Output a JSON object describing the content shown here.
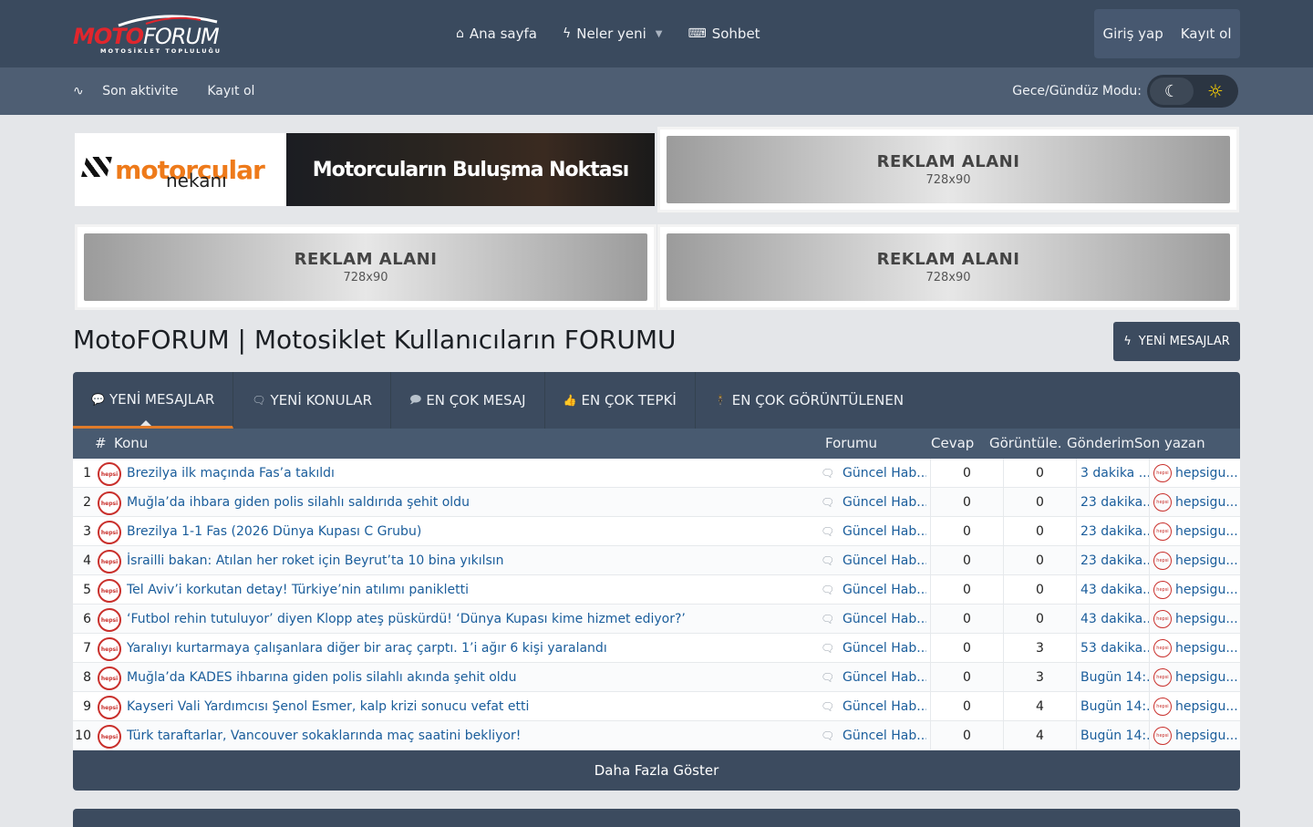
{
  "header": {
    "logo": {
      "moto": "MOTO",
      "forum": "FORUM",
      "subtitle": "MOTOSİKLET TOPLULUĞU"
    },
    "nav": [
      {
        "label": "Ana sayfa",
        "icon": "home-icon"
      },
      {
        "label": "Neler yeni",
        "icon": "bolt-icon"
      },
      {
        "label": "Sohbet",
        "icon": "chat-icon"
      }
    ],
    "login": "Giriş yap",
    "register": "Kayıt ol"
  },
  "subnav": {
    "activity": "Son aktivite",
    "register": "Kayıt ol",
    "mode_label": "Gece/Gündüz Modu:"
  },
  "ads": {
    "banner_brand": "motorcular",
    "banner_brand2": "nekanı",
    "banner_text": "Motorcuların Buluşma Noktası",
    "placeholder_title": "REKLAM ALANI",
    "placeholder_size": "728x90"
  },
  "page": {
    "title": "MotoFORUM | Motosiklet Kullanıcıların FORUMU",
    "new_messages_button": "YENİ MESAJLAR"
  },
  "tabs": [
    {
      "label": "YENİ MESAJLAR",
      "icon": "chat-bubble-icon",
      "active": true
    },
    {
      "label": "YENİ KONULAR",
      "icon": "chat-bubbles-icon",
      "active": false
    },
    {
      "label": "EN ÇOK MESAJ",
      "icon": "message-icon",
      "active": false
    },
    {
      "label": "EN ÇOK TEPKİ",
      "icon": "thumbs-up-icon",
      "active": false
    },
    {
      "label": "EN ÇOK GÖRÜNTÜLENEN",
      "icon": "eye-person-icon",
      "active": false
    }
  ],
  "table": {
    "headers": {
      "hash": "#",
      "topic": "Konu",
      "forum": "Forumu",
      "answers": "Cevap",
      "views": "Görüntüle...",
      "sent": "Gönderim",
      "last": "Son yazan"
    },
    "rows": [
      {
        "n": "1",
        "title": "Brezilya ilk maçında Fas’a takıldı",
        "forum": "Güncel Hab...",
        "answers": "0",
        "views": "0",
        "time": "3 dakika ...",
        "last": "hepsigu..."
      },
      {
        "n": "2",
        "title": "Muğla’da ihbara giden polis silahlı saldırıda şehit oldu",
        "forum": "Güncel Hab...",
        "answers": "0",
        "views": "0",
        "time": "23 dakika...",
        "last": "hepsigu..."
      },
      {
        "n": "3",
        "title": "Brezilya 1-1 Fas (2026 Dünya Kupası C Grubu)",
        "forum": "Güncel Hab...",
        "answers": "0",
        "views": "0",
        "time": "23 dakika...",
        "last": "hepsigu..."
      },
      {
        "n": "4",
        "title": "İsrailli bakan: Atılan her roket için Beyrut’ta 10 bina yıkılsın",
        "forum": "Güncel Hab...",
        "answers": "0",
        "views": "0",
        "time": "23 dakika...",
        "last": "hepsigu..."
      },
      {
        "n": "5",
        "title": "Tel Aviv’i korkutan detay! Türkiye’nin atılımı panikletti",
        "forum": "Güncel Hab...",
        "answers": "0",
        "views": "0",
        "time": "43 dakika...",
        "last": "hepsigu..."
      },
      {
        "n": "6",
        "title": "‘Futbol rehin tutuluyor’ diyen Klopp ateş püskürdü! ‘Dünya Kupası kime hizmet ediyor?’",
        "forum": "Güncel Hab...",
        "answers": "0",
        "views": "0",
        "time": "43 dakika...",
        "last": "hepsigu..."
      },
      {
        "n": "7",
        "title": "Yaralıyı kurtarmaya çalışanlara diğer bir araç çarptı. 1’i ağır 6 kişi yaralandı",
        "forum": "Güncel Hab...",
        "answers": "0",
        "views": "3",
        "time": "53 dakika...",
        "last": "hepsigu..."
      },
      {
        "n": "8",
        "title": "Muğla’da KADES ihbarına giden polis silahlı akında şehit oldu",
        "forum": "Güncel Hab...",
        "answers": "0",
        "views": "3",
        "time": "Bugün 14:...",
        "last": "hepsigu..."
      },
      {
        "n": "9",
        "title": "Kayseri Vali Yardımcısı Şenol Esmer, kalp krizi sonucu vefat etti",
        "forum": "Güncel Hab...",
        "answers": "0",
        "views": "4",
        "time": "Bugün 14:...",
        "last": "hepsigu..."
      },
      {
        "n": "10",
        "title": "Türk taraftarlar, Vancouver sokaklarında maç saatini bekliyor!",
        "forum": "Güncel Hab...",
        "answers": "0",
        "views": "4",
        "time": "Bugün 14:...",
        "last": "hepsigu..."
      }
    ],
    "avatar_text": "hepsi",
    "more_button": "Daha Fazla Göster"
  },
  "colors": {
    "header": "#3a4a5e",
    "subheader": "#4e5e73",
    "accent": "#e07b2a",
    "link": "#1a5d9b",
    "brand_red": "#e1262d"
  }
}
